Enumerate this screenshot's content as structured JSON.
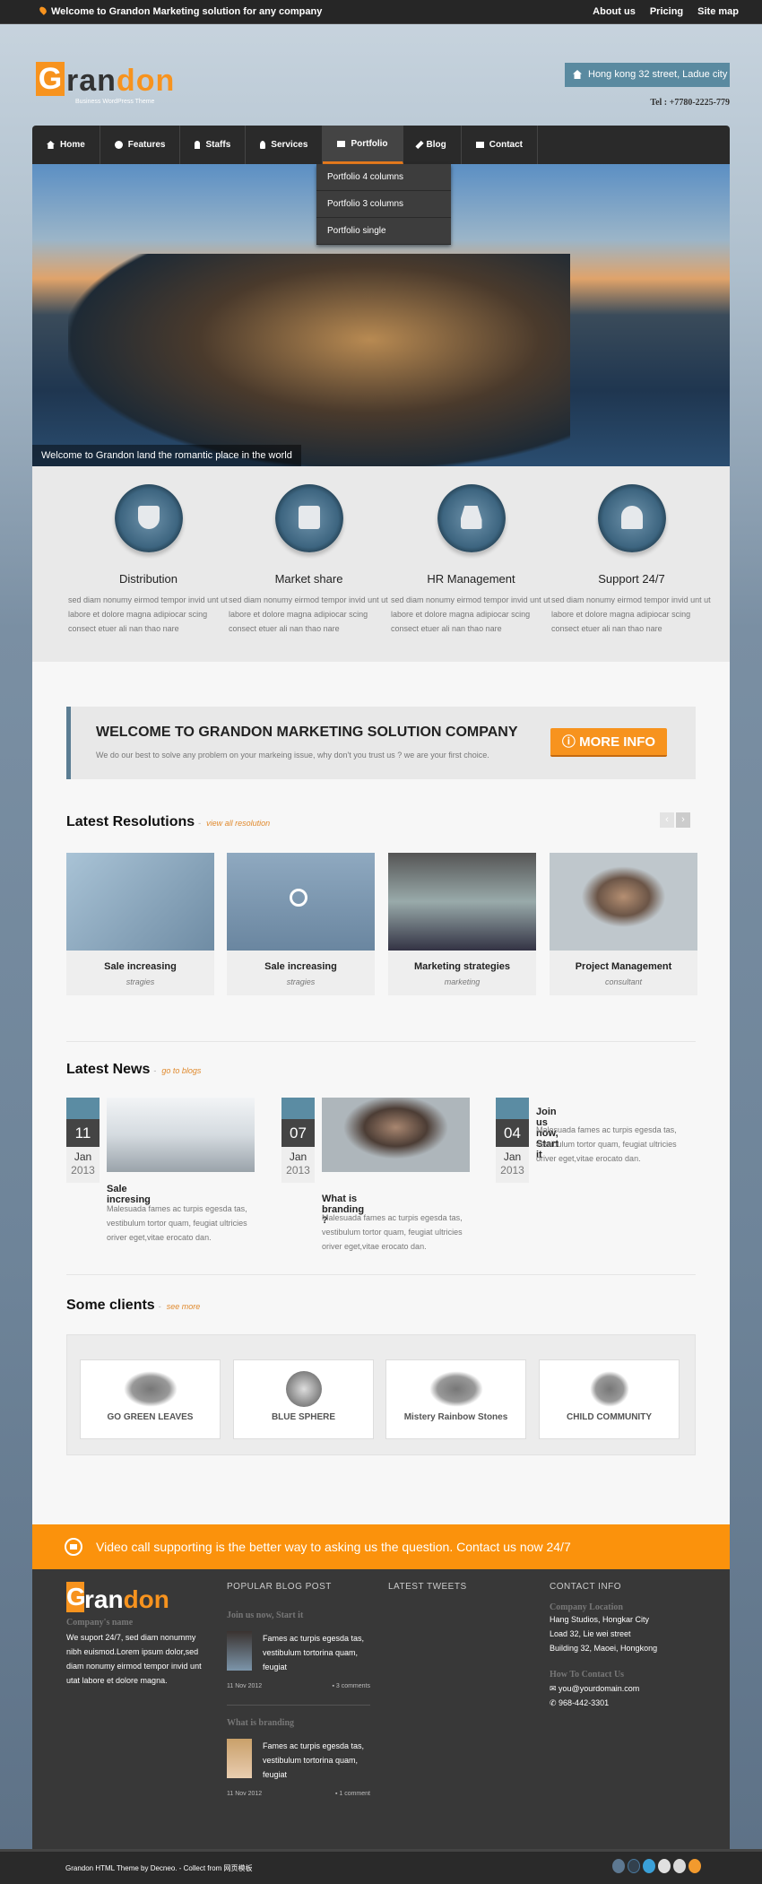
{
  "topbar": {
    "welcome": "Welcome to Grandon Marketing solution for any company",
    "links": [
      "About us",
      "Pricing",
      "Site map"
    ]
  },
  "header": {
    "logo_g": "G",
    "logo_ran": "ran",
    "logo_don": "don",
    "tagline": "Business WordPress Theme",
    "address": "Hong kong 32 street, Ladue city",
    "tel": "Tel : +7780-2225-779"
  },
  "nav": {
    "items": [
      {
        "label": "Home",
        "icon": "home-icon"
      },
      {
        "label": "Features",
        "icon": "gear-icon"
      },
      {
        "label": "Staffs",
        "icon": "user-icon"
      },
      {
        "label": "Services",
        "icon": "lightbulb-icon"
      },
      {
        "label": "Portfolio",
        "icon": "briefcase-icon"
      },
      {
        "label": "Blog",
        "icon": "pencil-icon"
      },
      {
        "label": "Contact",
        "icon": "envelope-icon"
      }
    ],
    "dropdown": [
      "Portfolio 4 columns",
      "Portfolio 3 columns",
      "Portfolio single"
    ]
  },
  "hero": {
    "caption": "Welcome to Grandon land the romantic place in the world"
  },
  "features": [
    {
      "title": "Distribution",
      "icon": "trophy-icon",
      "text": "sed diam nonumy eirmod tempor invid unt ut labore et dolore magna adipiocar scing consect etuer ali nan thao nare"
    },
    {
      "title": "Market share",
      "icon": "briefcase-icon",
      "text": "sed diam nonumy eirmod tempor invid unt ut labore et dolore magna adipiocar scing consect etuer ali nan thao nare"
    },
    {
      "title": "HR Management",
      "icon": "inbox-download-icon",
      "text": "sed diam nonumy eirmod tempor invid unt ut labore et dolore magna adipiocar scing consect etuer ali nan thao nare"
    },
    {
      "title": "Support 24/7",
      "icon": "users-icon",
      "text": "sed diam nonumy eirmod tempor invid unt ut labore et dolore magna adipiocar scing consect etuer ali nan thao nare"
    }
  ],
  "welcome": {
    "title": "WELCOME TO GRANDON MARKETING SOLUTION COMPANY",
    "text": "We do our best to solve any problem on your markeing issue, why don't you trust us ? we are your first choice.",
    "button": "ⓘ MORE INFO"
  },
  "resolutions": {
    "title": "Latest Resolutions",
    "dash": "-",
    "link": "view all resolution",
    "cards": [
      {
        "title": "Sale increasing",
        "sub": "stragies"
      },
      {
        "title": "Sale increasing",
        "sub": "stragies"
      },
      {
        "title": "Marketing strategies",
        "sub": "marketing"
      },
      {
        "title": "Project Management",
        "sub": "consultant"
      }
    ]
  },
  "news": {
    "title": "Latest News",
    "dash": "-",
    "link": "go to blogs",
    "items": [
      {
        "day": "11",
        "month": "Jan",
        "year": "2013",
        "title": "Sale incresing",
        "text": "Malesuada fames ac turpis egesda tas, vestibulum tortor quam, feugiat ultricies oriver eget,vitae erocato dan."
      },
      {
        "day": "07",
        "month": "Jan",
        "year": "2013",
        "title": "What is branding ?",
        "text": "Malesuada fames ac turpis egesda tas, vestibulum tortor quam, feugiat ultricies oriver eget,vitae erocato dan."
      },
      {
        "day": "04",
        "month": "Jan",
        "year": "2013",
        "title": "Join us now, Start it",
        "text": "Malesuada fames ac turpis egesda tas, vestibulum tortor quam, feugiat ultricies oriver eget,vitae erocato dan."
      }
    ]
  },
  "clients": {
    "title": "Some clients",
    "dash": "-",
    "link": "see more",
    "logos": [
      "GO GREEN LEAVES",
      "BLUE SPHERE",
      "Mistery Rainbow Stones",
      "CHILD COMMUNITY"
    ]
  },
  "banner": {
    "text": "Video call supporting is the better way to asking us the question. Contact us now 24/7"
  },
  "footer": {
    "company_label": "Company's name",
    "about": "We suport 24/7, sed diam nonummy nibh euismod.Lorem ipsum dolor,sed diam nonumy eirmod tempor invid unt utat labore et dolore magna.",
    "blog_title": "POPULAR BLOG POST",
    "posts": [
      {
        "title": "Join us now, Start it",
        "text": "Fames ac turpis egesda tas, vestibulum tortorina quam, feugiat",
        "date": "11 Nov 2012",
        "comments": "3 comments"
      },
      {
        "title": "What is branding",
        "text": "Fames ac turpis egesda tas, vestibulum tortorina quam, feugiat",
        "date": "11 Nov 2012",
        "comments": "1 comment"
      }
    ],
    "tweets_title": "LATEST TWEETS",
    "contact_title": "CONTACT INFO",
    "location_label": "Company Location",
    "location": [
      "Hang Studios, Hongkar City",
      "Load 32, Lie wei street",
      "Building 32, Maoei, Hongkong"
    ],
    "how_label": "How To Contact Us",
    "email": "you@yourdomain.com",
    "phone": "968-442-3301"
  },
  "bottom": {
    "copyright": "Grandon HTML Theme by Decneo. - Collect from 网页模板",
    "social": [
      "facebook-icon",
      "google-icon",
      "twitter-icon",
      "flickr-icon",
      "youtube-icon",
      "rss-icon"
    ]
  },
  "colors": {
    "accent": "#f7931e",
    "steel": "#5b8ca3",
    "dark": "#383838"
  }
}
